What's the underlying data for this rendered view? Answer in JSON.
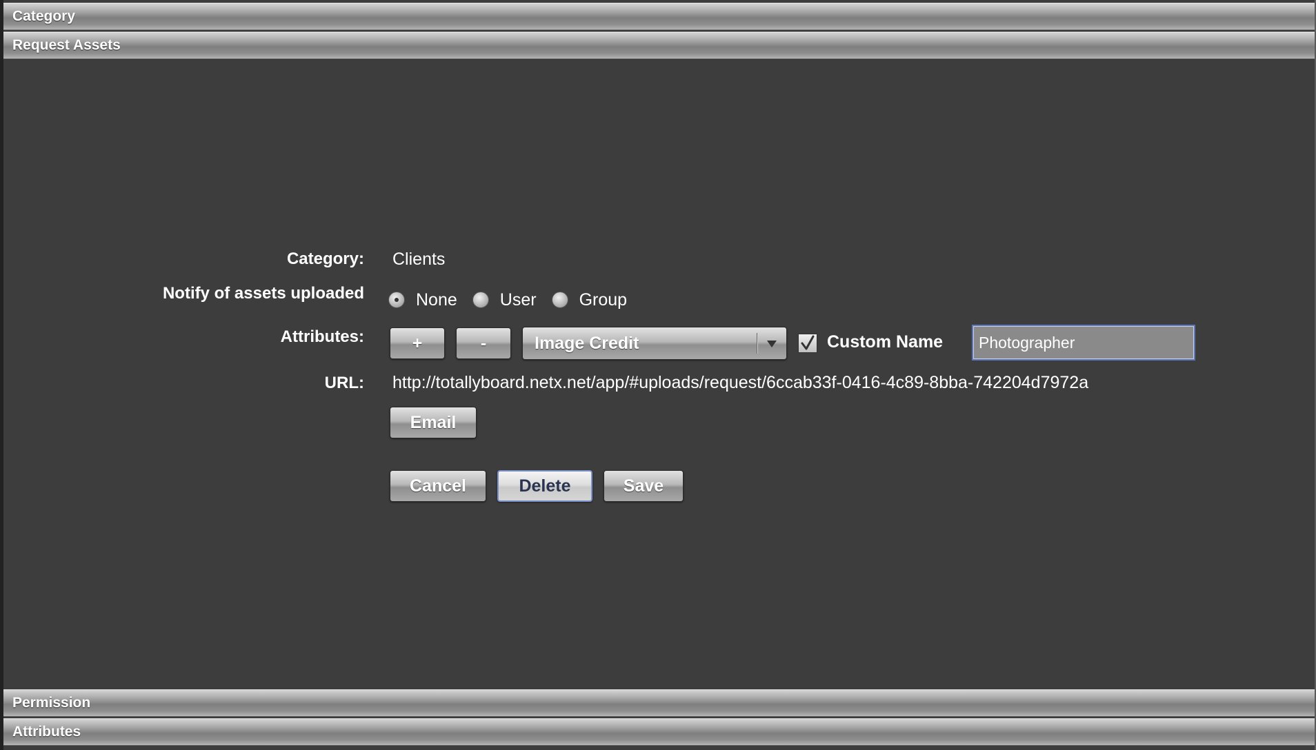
{
  "sections": {
    "category": "Category",
    "request_assets": "Request Assets",
    "permission": "Permission",
    "attributes": "Attributes"
  },
  "form": {
    "category_label": "Category:",
    "category_value": "Clients",
    "notify_label": "Notify of assets uploaded",
    "notify_options": [
      "None",
      "User",
      "Group"
    ],
    "notify_selected": "None",
    "attributes_label": "Attributes:",
    "add_label": "+",
    "remove_label": "-",
    "attribute_selected": "Image Credit",
    "custom_name_checked": true,
    "custom_name_label": "Custom Name",
    "custom_name_value": "Photographer",
    "url_label": "URL:",
    "url_value": "http://totallyboard.netx.net/app/#uploads/request/6ccab33f-0416-4c89-8bba-742204d7972a",
    "email_label": "Email",
    "cancel_label": "Cancel",
    "delete_label": "Delete",
    "save_label": "Save"
  },
  "colors": {
    "background": "#3d3d3d",
    "focus_border": "#7b8fc9"
  }
}
